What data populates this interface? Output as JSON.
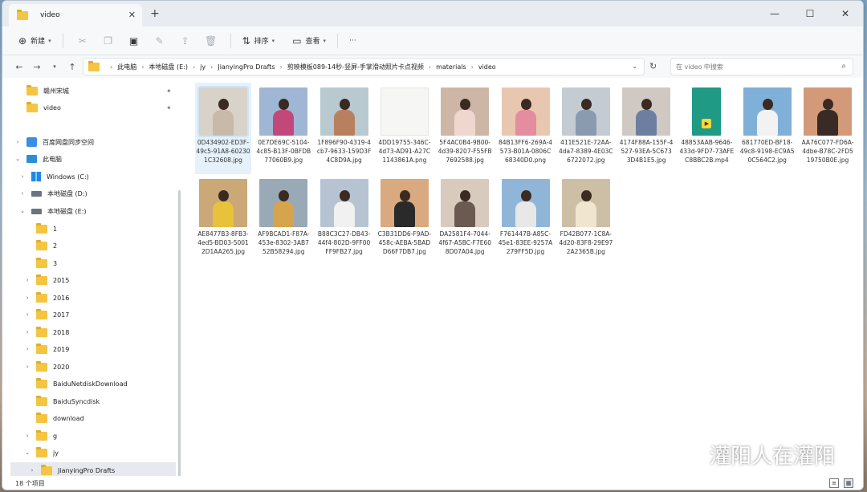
{
  "window": {
    "tab_title": "video",
    "tab_close": "✕",
    "new_tab": "+",
    "controls": {
      "minimize": "—",
      "maximize": "☐",
      "close": "✕"
    }
  },
  "toolbar": {
    "new_label": "新建",
    "sort_label": "排序",
    "view_label": "查看",
    "more_label": "···"
  },
  "address": {
    "crumbs": [
      "此电脑",
      "本地磁盘 (E:)",
      "jy",
      "JianyingPro Drafts",
      "剪映模板089-14秒-竖屏-手掌滑动照片卡点视频",
      "materials",
      "video"
    ],
    "search_placeholder": "在 video 中搜索"
  },
  "sidebar": {
    "quick": [
      {
        "label": "赣州宋城"
      },
      {
        "label": "video"
      }
    ],
    "cloud": "百度网盘同步空间",
    "pc": "此电脑",
    "drives": [
      {
        "label": "Windows (C:)"
      },
      {
        "label": "本地磁盘 (D:)"
      },
      {
        "label": "本地磁盘 (E:)"
      }
    ],
    "e_folders": [
      "1",
      "2",
      "3",
      "2015",
      "2016",
      "2017",
      "2018",
      "2019",
      "2020",
      "BaiduNetdiskDownload",
      "BaiduSyncdisk",
      "download",
      "g",
      "jy",
      "JianyingPro Drafts"
    ]
  },
  "files": [
    {
      "name": "0D434902-ED3F-49c5-91A8-602301C32608.jpg",
      "bg": "#d8d2c8",
      "body": "#c9b9a8"
    },
    {
      "name": "0E7DE69C-5104-4c85-B13F-0BFDB77060B9.jpg",
      "bg": "#9fb7d4",
      "body": "#c2487a"
    },
    {
      "name": "1F896F90-4319-4cb7-9633-159D3F4C8D9A.jpg",
      "bg": "#b8c9cf",
      "body": "#b98060"
    },
    {
      "name": "4DD19755-346C-4d73-AD91-A27C1143861A.png",
      "bg": "#f6f6f4",
      "body": "#f6f6f4"
    },
    {
      "name": "5F4AC0B4-9B00-4d39-8207-F55FB7692588.jpg",
      "bg": "#cdb6a6",
      "body": "#efd7d0"
    },
    {
      "name": "84B13FF6-269A-4573-B01A-0806C68340D0.png",
      "bg": "#e8c7b0",
      "body": "#e48ca0"
    },
    {
      "name": "411E521E-72AA-4da7-8389-4E03C6722072.jpg",
      "bg": "#c4cbd2",
      "body": "#8a9bb0"
    },
    {
      "name": "4174F88A-155F-4527-93EA-5C6733D4B1E5.jpg",
      "bg": "#d0c8c2",
      "body": "#6e7ea0"
    },
    {
      "name": "48853AAB-9646-433d-9FD7-73AFEC8BBC2B.mp4",
      "bg": "#1f9a84",
      "body": "#1f9a84"
    },
    {
      "name": "681770ED-BF18-49c8-9198-EC9A50C564C2.jpg",
      "bg": "#7fb0d8",
      "body": "#f2f2f2"
    },
    {
      "name": "AA76C077-FD6A-4dbe-B78C-2FD519750B0E.jpg",
      "bg": "#d39a7a",
      "body": "#3a2a26"
    },
    {
      "name": "AE8477B3-8FB3-4ed5-BD03-50012D1AA265.jpg",
      "bg": "#caa878",
      "body": "#e8c23a"
    },
    {
      "name": "AF9BCAD1-F87A-453e-8302-3AB752B58294.jpg",
      "bg": "#9aa9b6",
      "body": "#d6a44c"
    },
    {
      "name": "B88C3C27-DB43-44f4-802D-9FF00FF9FB27.jpg",
      "bg": "#b6c3d2",
      "body": "#f1f1f1"
    },
    {
      "name": "C3B31DD6-F9AD-458c-AEBA-5BADD66F7DB7.jpg",
      "bg": "#d9a980",
      "body": "#2a2a2a"
    },
    {
      "name": "DA2581F4-7044-4f67-A5BC-F7E608D07A04.jpg",
      "bg": "#d8cbbd",
      "body": "#6a5a50"
    },
    {
      "name": "F761447B-A85C-45e1-83EE-9257A279FF5D.jpg",
      "bg": "#8fb6d8",
      "body": "#e8e8e8"
    },
    {
      "name": "FD42B077-1C8A-4d20-83F8-29E972A2365B.jpg",
      "bg": "#cdbfa6",
      "body": "#f0e6d0"
    }
  ],
  "status": {
    "count": "18 个项目"
  },
  "watermark": {
    "text": "灌阳人在灌阳"
  }
}
